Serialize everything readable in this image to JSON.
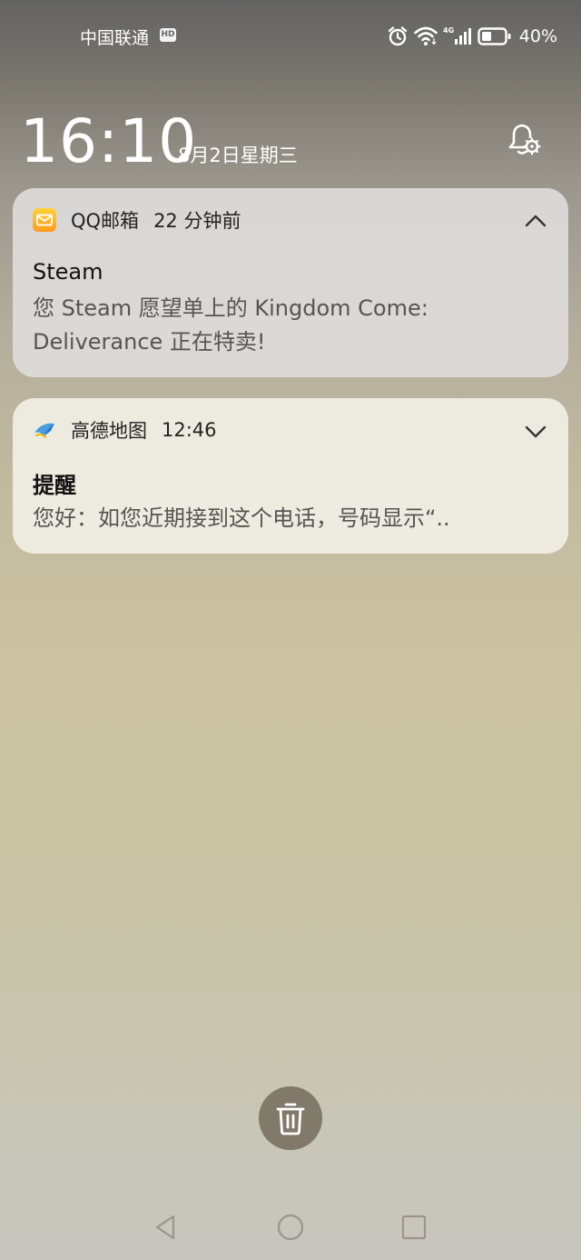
{
  "status_bar": {
    "carrier": "中国联通",
    "hd_badge": "HD",
    "network_type": "4G",
    "battery_level": "40%",
    "icons": [
      "alarm-icon",
      "wifi-icon",
      "signal-icon",
      "battery-icon"
    ]
  },
  "lockscreen": {
    "time": "16:10",
    "date": "8月2日星期三",
    "settings_icon": "bell-settings-icon"
  },
  "notifications": [
    {
      "app_name": "QQ邮箱",
      "time": "22 分钟前",
      "title": "Steam",
      "body": "您 Steam 愿望单上的 Kingdom Come: Deliverance 正在特卖!",
      "expanded": true,
      "icon": "qq-mail-icon"
    },
    {
      "app_name": "高德地图",
      "time": "12:46",
      "title": "提醒",
      "body": "您好：如您近期接到这个电话，号码显示“..",
      "expanded": false,
      "icon": "amap-icon"
    }
  ],
  "actions": {
    "clear_all_icon": "trash-icon"
  },
  "navigation": [
    "back-icon",
    "home-icon",
    "recent-apps-icon"
  ]
}
